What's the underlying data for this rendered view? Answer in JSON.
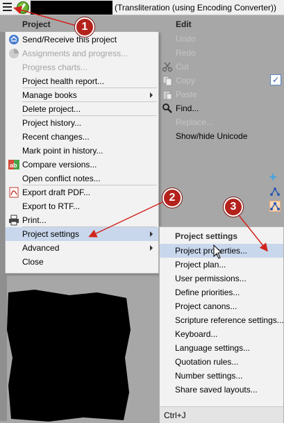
{
  "titlebar": {
    "title": "(Transliteration (using Encoding Converter))"
  },
  "menubar": {
    "project_label": "Project",
    "edit_label": "Edit"
  },
  "project_menu": {
    "items": [
      {
        "label": "Send/Receive this project",
        "icon": "send-receive-icon",
        "enabled": true
      },
      {
        "label": "Assignments and progress...",
        "icon": "progress-chart-icon",
        "enabled": false
      },
      {
        "label": "Progress charts...",
        "enabled": false
      },
      {
        "label": "Project health report...",
        "enabled": true
      },
      {
        "label": "Manage books",
        "submenu": true,
        "enabled": true
      },
      {
        "label": "Delete project...",
        "enabled": true
      },
      {
        "label": "Project history...",
        "enabled": true
      },
      {
        "label": "Recent changes...",
        "enabled": true
      },
      {
        "label": "Mark point in history...",
        "enabled": true
      },
      {
        "label": "Compare versions...",
        "icon": "compare-icon",
        "enabled": true
      },
      {
        "label": "Open conflict notes...",
        "enabled": true
      },
      {
        "label": "Export draft PDF...",
        "icon": "pdf-icon",
        "enabled": true
      },
      {
        "label": "Export to RTF...",
        "enabled": true
      },
      {
        "label": "Print...",
        "icon": "printer-icon",
        "enabled": true
      },
      {
        "label": "Project settings",
        "submenu": true,
        "enabled": true,
        "selected": true
      },
      {
        "label": "Advanced",
        "submenu": true,
        "enabled": true
      },
      {
        "label": "Close",
        "enabled": true
      }
    ]
  },
  "edit_menu": {
    "items": [
      {
        "label": "Undo",
        "enabled": false
      },
      {
        "label": "Redo",
        "enabled": false
      },
      {
        "label": "Cut",
        "icon": "scissors-icon",
        "enabled": false
      },
      {
        "label": "Copy",
        "icon": "copy-icon",
        "enabled": false
      },
      {
        "label": "Paste",
        "icon": "paste-icon",
        "enabled": false
      },
      {
        "label": "Find...",
        "icon": "magnifier-icon",
        "enabled": true
      },
      {
        "label": "Replace...",
        "enabled": false
      },
      {
        "label": "Show/hide Unicode",
        "enabled": true
      }
    ]
  },
  "submenu": {
    "header": "Project settings",
    "items": [
      {
        "label": "Project properties...",
        "selected": true
      },
      {
        "label": "Project plan..."
      },
      {
        "label": "User permissions..."
      },
      {
        "label": "Define priorities..."
      },
      {
        "label": "Project canons..."
      },
      {
        "label": "Scripture reference settings..."
      },
      {
        "label": "Keyboard..."
      },
      {
        "label": "Language settings..."
      },
      {
        "label": "Quotation rules..."
      },
      {
        "label": "Number settings..."
      },
      {
        "label": "Share saved layouts..."
      }
    ],
    "shortcut": "Ctrl+J"
  },
  "annotations": [
    "1",
    "2",
    "3"
  ],
  "colors": {
    "menu_bg": "#f2f2f2",
    "selected_bg": "#c9d7ec",
    "annotation_red": "#b4221c",
    "disabled_text": "#a3a3a3"
  }
}
